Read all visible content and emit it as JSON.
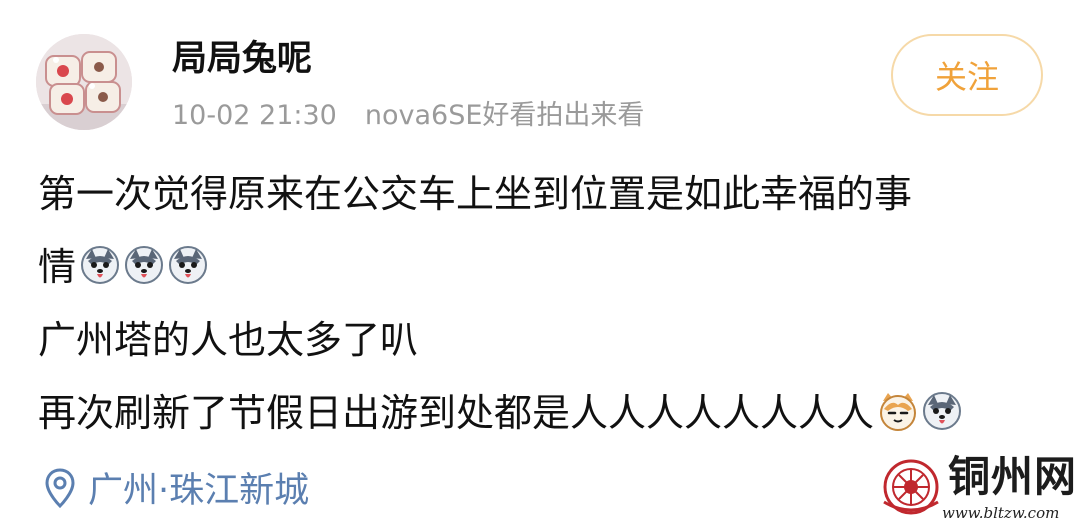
{
  "post": {
    "username": "局局兔呢",
    "timestamp": "10-02 21:30",
    "source": "nova6SE好看拍出来看",
    "follow_label": "关注",
    "content": {
      "line1": "第一次觉得原来在公交车上坐到位置是如此幸福的事",
      "line2": "情",
      "line3": "广州塔的人也太多了叭",
      "line4": "再次刷新了节假日出游到处都是人人人人人人人人"
    },
    "emojis": {
      "line2": [
        "husky-emoji",
        "husky-emoji",
        "husky-emoji"
      ],
      "line4": [
        "cat-emoji",
        "husky-emoji"
      ]
    },
    "location": {
      "icon": "location-pin-icon",
      "text": "广州·珠江新城"
    }
  },
  "watermark": {
    "title": "铜州网",
    "url": "www.bltzw.com"
  },
  "colors": {
    "follow_text": "#f0a23a",
    "follow_border": "#f6d9a8",
    "meta_text": "#9a9a9a",
    "location_text": "#5b7fb0",
    "watermark_red": "#c0282e"
  }
}
